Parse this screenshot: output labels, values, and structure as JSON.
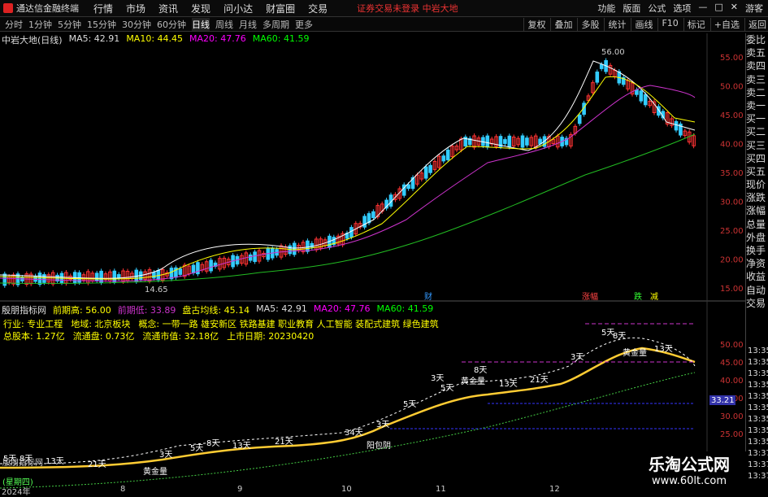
{
  "app": {
    "title": "通达信金融终端",
    "menu": [
      "行情",
      "市场",
      "资讯",
      "发现",
      "问小达",
      "财富圈",
      "交易"
    ],
    "notice": "证券交易未登录  中岩大地",
    "right_menu": [
      "功能",
      "版面",
      "公式",
      "选项"
    ],
    "guest": "游客"
  },
  "toolbar": {
    "timeframes": [
      "分时",
      "1分钟",
      "5分钟",
      "15分钟",
      "30分钟",
      "60分钟",
      "日线",
      "周线",
      "月线",
      "多周期",
      "更多"
    ],
    "active": "日线",
    "right": [
      "复权",
      "叠加",
      "多股",
      "统计",
      "画线",
      "F10",
      "标记",
      "+自选",
      "返回"
    ]
  },
  "kline": {
    "name": "中岩大地(日线)",
    "ma5": "MA5: 42.91",
    "ma10": "MA10: 44.45",
    "ma20": "MA20: 47.76",
    "ma60": "MA60: 41.59",
    "high_mark": "56.00",
    "low_mark": "14.65",
    "yticks": [
      "55.00",
      "50.00",
      "45.00",
      "40.00",
      "35.00",
      "30.00",
      "25.00",
      "20.00",
      "15.00"
    ]
  },
  "markers": [
    "财",
    "涨幅",
    "跌",
    "减"
  ],
  "sidebar": [
    "委比",
    "卖五",
    "卖四",
    "卖三",
    "卖二",
    "卖一",
    "买一",
    "买二",
    "买三",
    "买四",
    "买五",
    "现价",
    "涨跌",
    "涨幅",
    "总量",
    "外盘",
    "换手",
    "净资",
    "收益",
    "自动",
    "交易"
  ],
  "panel2": {
    "name": "殷朋指标网",
    "prev_high": "前期高: 56.00",
    "prev_low": "前期低: 33.89",
    "center": "盘古均线: 45.14",
    "ma5": "MA5: 42.91",
    "ma20": "MA20: 47.76",
    "ma60": "MA60: 41.59",
    "industry": "行业: 专业工程",
    "region": "地域: 北京板块",
    "concept": "概念: 一带一路 雄安新区 铁路基建 职业教育 人工智能 装配式建筑 绿色建筑",
    "total": "总股本: 1.27亿",
    "float": "流通盘: 0.73亿",
    "mktcap": "流通市值: 32.18亿",
    "ipo": "上市日期: 20230420",
    "yticks": [
      "50.00",
      "45.00",
      "40.00",
      "35.00",
      "30.00",
      "25.00"
    ],
    "price_tag": "33.21",
    "labels": [
      "5天",
      "8天",
      "13天",
      "21天",
      "3天",
      "5天",
      "8天",
      "13天",
      "21天",
      "34天",
      "黄金量",
      "阳包阴",
      "3天",
      "5天",
      "3天",
      "5天",
      "黄金量",
      "8天",
      "13天",
      "21天",
      "3天",
      "5天",
      "8天",
      "黄金量",
      "13天"
    ],
    "times": [
      "13:35",
      "13:35",
      "13:35",
      "13:35",
      "13:35",
      "13:35",
      "13:35",
      "13:35",
      "13:35",
      "13:37",
      "13:37",
      "13:37"
    ],
    "bottom1": "殷朋指标网",
    "bottom2": "(星期四)"
  },
  "dates": [
    "2024年",
    "8",
    "9",
    "10",
    "11",
    "12"
  ],
  "watermark": {
    "line1": "乐淘公式网",
    "line2": "www.60lt.com"
  }
}
